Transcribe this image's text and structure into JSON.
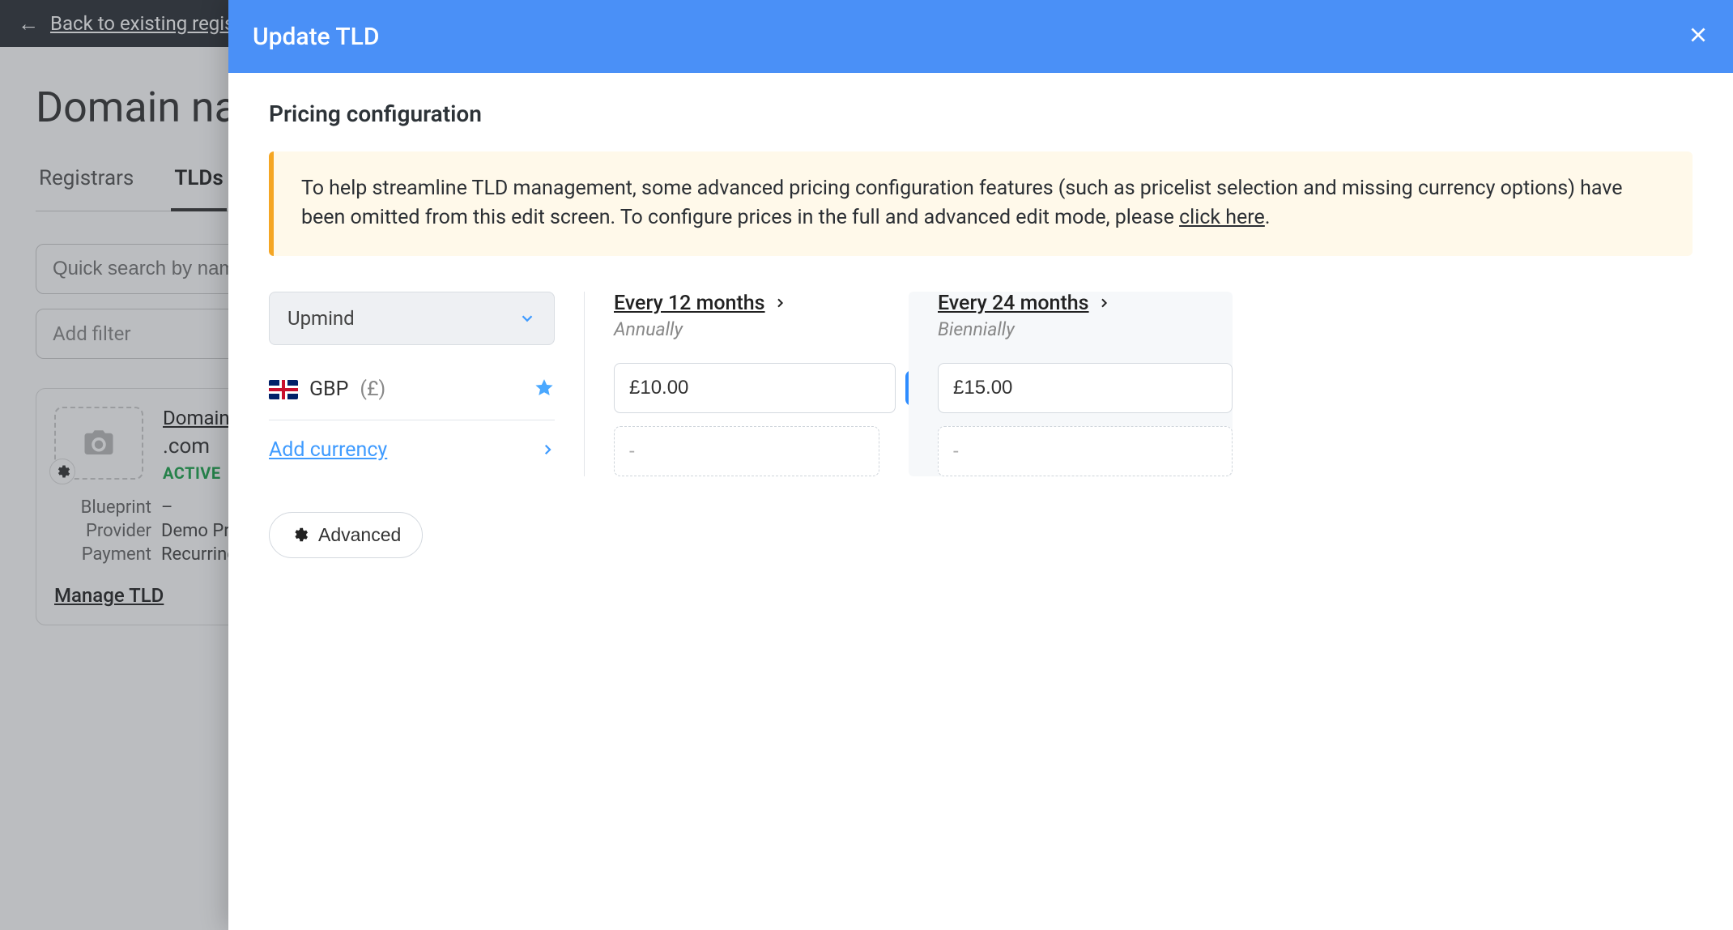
{
  "background": {
    "back_link": "Back to existing registrars",
    "page_title": "Domain names",
    "tabs": [
      "Registrars",
      "TLDs"
    ],
    "active_tab": 1,
    "search_placeholder": "Quick search by name",
    "filter_placeholder": "Add filter",
    "card": {
      "title_link": "Domain Name",
      "tld": ".com",
      "status": "ACTIVE",
      "meta": {
        "blueprint_label": "Blueprint",
        "blueprint_value": "–",
        "provider_label": "Provider",
        "provider_value": "Demo Provider",
        "payment_label": "Payment",
        "payment_value": "Recurring"
      },
      "manage_link": "Manage TLD"
    }
  },
  "drawer": {
    "title": "Update TLD",
    "section_title": "Pricing configuration",
    "notice_text": "To help streamline TLD management, some advanced pricing configuration features (such as pricelist selection and missing currency options) have been omitted from this edit screen. To configure prices in the full and advanced edit mode, please ",
    "notice_link": "click here",
    "provider_selected": "Upmind",
    "currency": {
      "code": "GBP",
      "symbol": "(£)"
    },
    "add_currency": "Add currency",
    "periods": [
      {
        "title": "Every 12 months",
        "sub": "Annually",
        "price": "£10.00",
        "checked": true,
        "ghost": "-"
      },
      {
        "title": "Every 24 months",
        "sub": "Biennially",
        "price": "£15.00",
        "checked": false,
        "ghost": "-"
      }
    ],
    "advanced_label": "Advanced"
  }
}
